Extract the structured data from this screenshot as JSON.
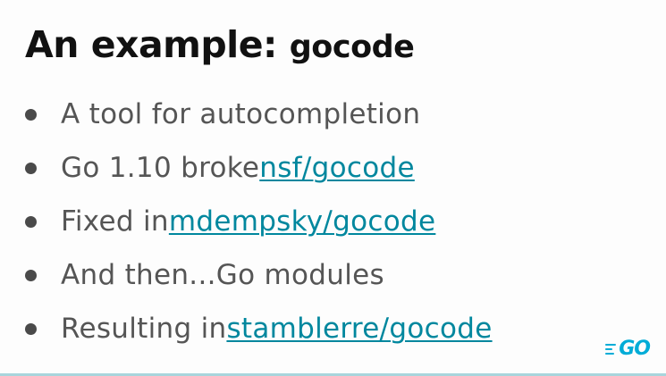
{
  "slide": {
    "title": {
      "main": "An example: ",
      "code": "gocode"
    },
    "bullets": [
      {
        "text": "A tool for autocompletion",
        "link": ""
      },
      {
        "text": "Go 1.10 broke ",
        "link": "nsf/gocode"
      },
      {
        "text": "Fixed in ",
        "link": "mdempsky/gocode"
      },
      {
        "text": "And then...Go modules",
        "link": ""
      },
      {
        "text": "Resulting in ",
        "link": "stamblerre/gocode"
      }
    ],
    "logo": {
      "text": "GO"
    }
  },
  "colors": {
    "background": "#fdfdfd",
    "title": "#111111",
    "body_text": "#555555",
    "link": "#00879e",
    "bullet": "#4a4a4a",
    "go_brand": "#00acd7",
    "bottom_border": "#a8d5dc"
  }
}
